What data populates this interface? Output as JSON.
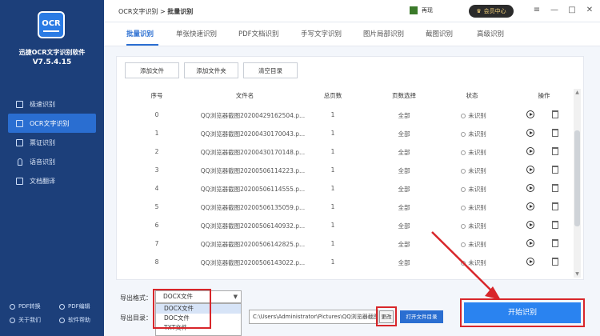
{
  "sidebar": {
    "logo_text": "OCR",
    "app_name": "迅捷OCR文字识别软件",
    "version": "V7.5.4.15",
    "nav": [
      {
        "label": "极速识别",
        "icon": "lightning-icon"
      },
      {
        "label": "OCR文字识别",
        "icon": "ocr-icon"
      },
      {
        "label": "票证识别",
        "icon": "ticket-icon"
      },
      {
        "label": "语音识别",
        "icon": "microphone-icon"
      },
      {
        "label": "文档翻译",
        "icon": "translate-icon"
      }
    ],
    "footer": {
      "pdf_convert": "PDF转换",
      "pdf_edit": "PDF编辑",
      "about": "关于我们",
      "support": "软件帮助"
    }
  },
  "topbar": {
    "crumb_parent": "OCR文字识别",
    "crumb_sep": ">",
    "crumb_current": "批量识别",
    "username": "再现",
    "vip_label": "会员中心",
    "win_menu": "≡",
    "win_min": "—",
    "win_max": "□",
    "win_close": "✕"
  },
  "tabs": [
    "批量识别",
    "单张快速识别",
    "PDF文档识别",
    "手写文字识别",
    "图片局部识别",
    "截图识别",
    "高级识别"
  ],
  "toolbar": {
    "add_file": "添加文件",
    "add_folder": "添加文件夹",
    "clear": "清空目录"
  },
  "table": {
    "headers": [
      "序号",
      "文件名",
      "总页数",
      "页数选择",
      "状态",
      "操作"
    ],
    "rows": [
      {
        "index": "0",
        "name": "QQ浏览器截图20200429162504.p...",
        "pages": "1",
        "select": "全部",
        "status": "未识别"
      },
      {
        "index": "1",
        "name": "QQ浏览器截图20200430170043.p...",
        "pages": "1",
        "select": "全部",
        "status": "未识别"
      },
      {
        "index": "2",
        "name": "QQ浏览器截图20200430170148.p...",
        "pages": "1",
        "select": "全部",
        "status": "未识别"
      },
      {
        "index": "3",
        "name": "QQ浏览器截图20200506114223.p...",
        "pages": "1",
        "select": "全部",
        "status": "未识别"
      },
      {
        "index": "4",
        "name": "QQ浏览器截图20200506114555.p...",
        "pages": "1",
        "select": "全部",
        "status": "未识别"
      },
      {
        "index": "5",
        "name": "QQ浏览器截图20200506135059.p...",
        "pages": "1",
        "select": "全部",
        "status": "未识别"
      },
      {
        "index": "6",
        "name": "QQ浏览器截图20200506140932.p...",
        "pages": "1",
        "select": "全部",
        "status": "未识别"
      },
      {
        "index": "7",
        "name": "QQ浏览器截图20200506142825.p...",
        "pages": "1",
        "select": "全部",
        "status": "未识别"
      },
      {
        "index": "8",
        "name": "QQ浏览器截图20200506143022.p...",
        "pages": "1",
        "select": "全部",
        "status": "未识别"
      }
    ]
  },
  "export": {
    "format_label": "导出格式：",
    "format_value": "DOCX文件",
    "options": [
      "DOCX文件",
      "DOC文件",
      "TXT文件"
    ],
    "dir_label": "导出目录：",
    "dir_value": "C:\\Users\\Administrator\\Pictures\\QQ浏览器截图",
    "change_label": "更改",
    "open_dir_label": "打开文件目录",
    "start_label": "开始识别"
  },
  "colors": {
    "sidebar": "#1c3f7a",
    "accent": "#2a6ed1",
    "start_button": "#2a83f0",
    "highlight": "#d8262a"
  }
}
